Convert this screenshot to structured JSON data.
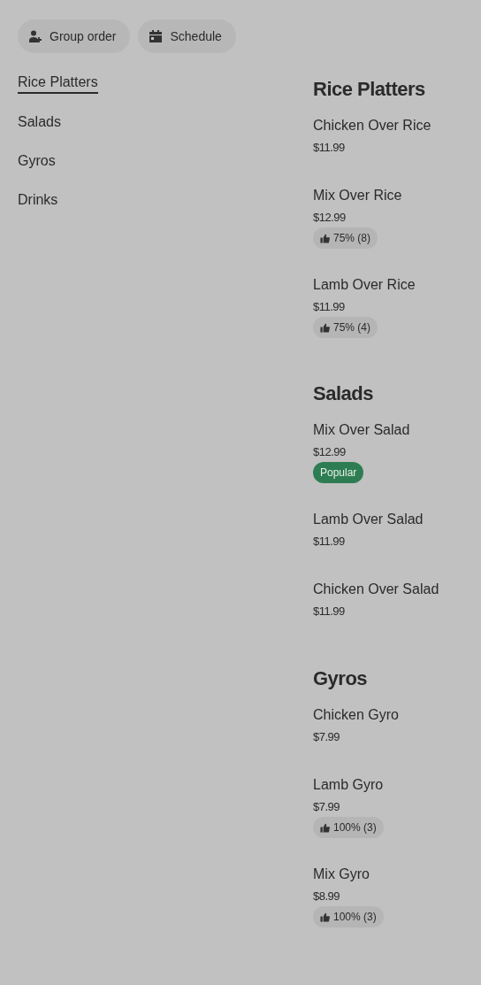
{
  "actions": [
    {
      "kind": "group",
      "label": "Group order"
    },
    {
      "kind": "schedule",
      "label": "Schedule"
    }
  ],
  "categories": [
    {
      "label": "Rice Platters",
      "selected": true
    },
    {
      "label": "Salads",
      "selected": false
    },
    {
      "label": "Gyros",
      "selected": false
    },
    {
      "label": "Drinks",
      "selected": false
    }
  ],
  "sections": [
    {
      "title": "Rice Platters",
      "items": [
        {
          "name": "Chicken Over Rice",
          "price": "$11.99"
        },
        {
          "name": "Mix Over Rice",
          "price": "$12.99",
          "rating": "75% (8)"
        },
        {
          "name": "Lamb Over Rice",
          "price": "$11.99",
          "rating": "75% (4)"
        }
      ]
    },
    {
      "title": "Salads",
      "items": [
        {
          "name": "Mix Over Salad",
          "price": "$12.99",
          "tag": "Popular"
        },
        {
          "name": "Lamb Over Salad",
          "price": "$11.99"
        },
        {
          "name": "Chicken Over Salad",
          "price": "$11.99"
        }
      ]
    },
    {
      "title": "Gyros",
      "items": [
        {
          "name": "Chicken Gyro",
          "price": "$7.99"
        },
        {
          "name": "Lamb Gyro",
          "price": "$7.99",
          "rating": "100% (3)"
        },
        {
          "name": "Mix Gyro",
          "price": "$8.99",
          "rating": "100% (3)"
        }
      ]
    }
  ]
}
